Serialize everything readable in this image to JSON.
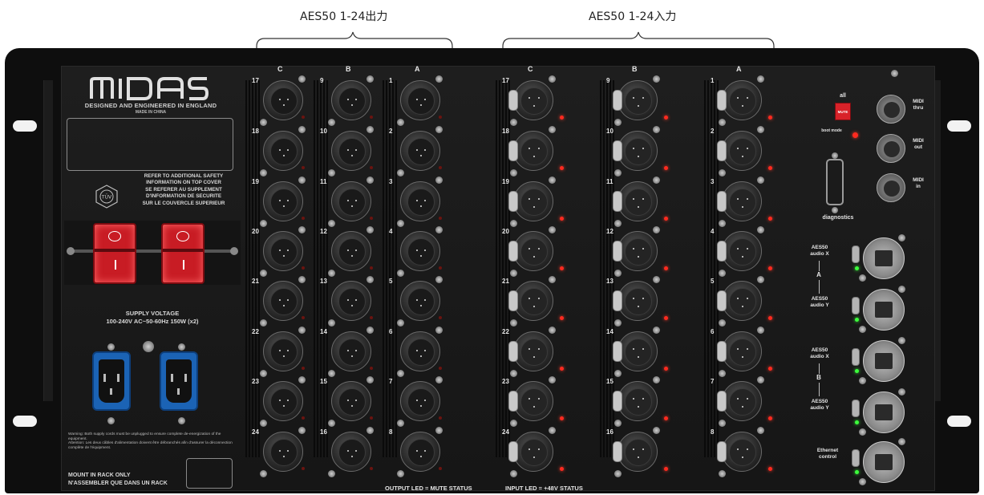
{
  "callouts": {
    "outputs_label": "AES50 1-24出力",
    "inputs_label": "AES50 1-24入力"
  },
  "branding": {
    "logo": "MIDAS",
    "tagline": "DESIGNED AND ENGINEERED IN ENGLAND",
    "made_in": "MADE IN CHINA"
  },
  "safety": {
    "line1": "REFER TO ADDITIONAL SAFETY",
    "line2": "INFORMATION ON TOP COVER",
    "line3": "SE REFERER AU SUPPLEMENT",
    "line4": "D'INFORMATION DE SECURITE",
    "line5": "SUR LE COUVERCLE SUPERIEUR"
  },
  "power": {
    "switch_off_symbol": "O",
    "switch_on_symbol": "I",
    "supply_title": "SUPPLY VOLTAGE",
    "supply_spec": "100-240V  AC~50-60Hz 150W (x2)",
    "warning_en": "Warning: Both supply cords must be unplugged to ensure complete de-energization of the equipment.",
    "warning_fr": "Attention: Les deux câbles d'alimentation doivent être débranchés afin d'assurer la déconnection complète de l'équipment."
  },
  "mount": {
    "line1": "MOUNT IN RACK ONLY",
    "line2": "N'ASSEMBLER QUE DANS UN RACK"
  },
  "outputs": {
    "column_letters": [
      "C",
      "B",
      "A"
    ],
    "columns": [
      [
        "17",
        "18",
        "19",
        "20",
        "21",
        "22",
        "23",
        "24"
      ],
      [
        "9",
        "10",
        "11",
        "12",
        "13",
        "14",
        "15",
        "16"
      ],
      [
        "1",
        "2",
        "3",
        "4",
        "5",
        "6",
        "7",
        "8"
      ]
    ],
    "status": "OUTPUT LED = MUTE STATUS"
  },
  "inputs": {
    "column_letters": [
      "C",
      "B",
      "A"
    ],
    "columns": [
      [
        "17",
        "18",
        "19",
        "20",
        "21",
        "22",
        "23",
        "24"
      ],
      [
        "9",
        "10",
        "11",
        "12",
        "13",
        "14",
        "15",
        "16"
      ],
      [
        "1",
        "2",
        "3",
        "4",
        "5",
        "6",
        "7",
        "8"
      ]
    ],
    "status": "INPUT LED = +48V STATUS"
  },
  "controls": {
    "all_label": "all",
    "mute_label": "MUTE",
    "boot_mode_label": "boot mode",
    "diagnostics_label": "diagnostics",
    "midi": [
      {
        "line1": "MIDI",
        "line2": "thru"
      },
      {
        "line1": "MIDI",
        "line2": "out"
      },
      {
        "line1": "MIDI",
        "line2": "in"
      }
    ],
    "aes50": [
      {
        "line1": "AES50",
        "line2": "audio X"
      },
      {
        "line1": "AES50",
        "line2": "audio Y"
      },
      {
        "line1": "AES50",
        "line2": "audio X"
      },
      {
        "line1": "AES50",
        "line2": "audio Y"
      }
    ],
    "group_a": "A",
    "group_b": "B",
    "ethernet": {
      "line1": "Ethernet",
      "line2": "control"
    }
  },
  "colors": {
    "chassis": "#0e0e0e",
    "panel": "#1a1a1a",
    "switch_red": "#c81c24",
    "iec_blue": "#1b63b5",
    "led_red": "#ff2a1f",
    "led_green": "#3cff3c"
  }
}
